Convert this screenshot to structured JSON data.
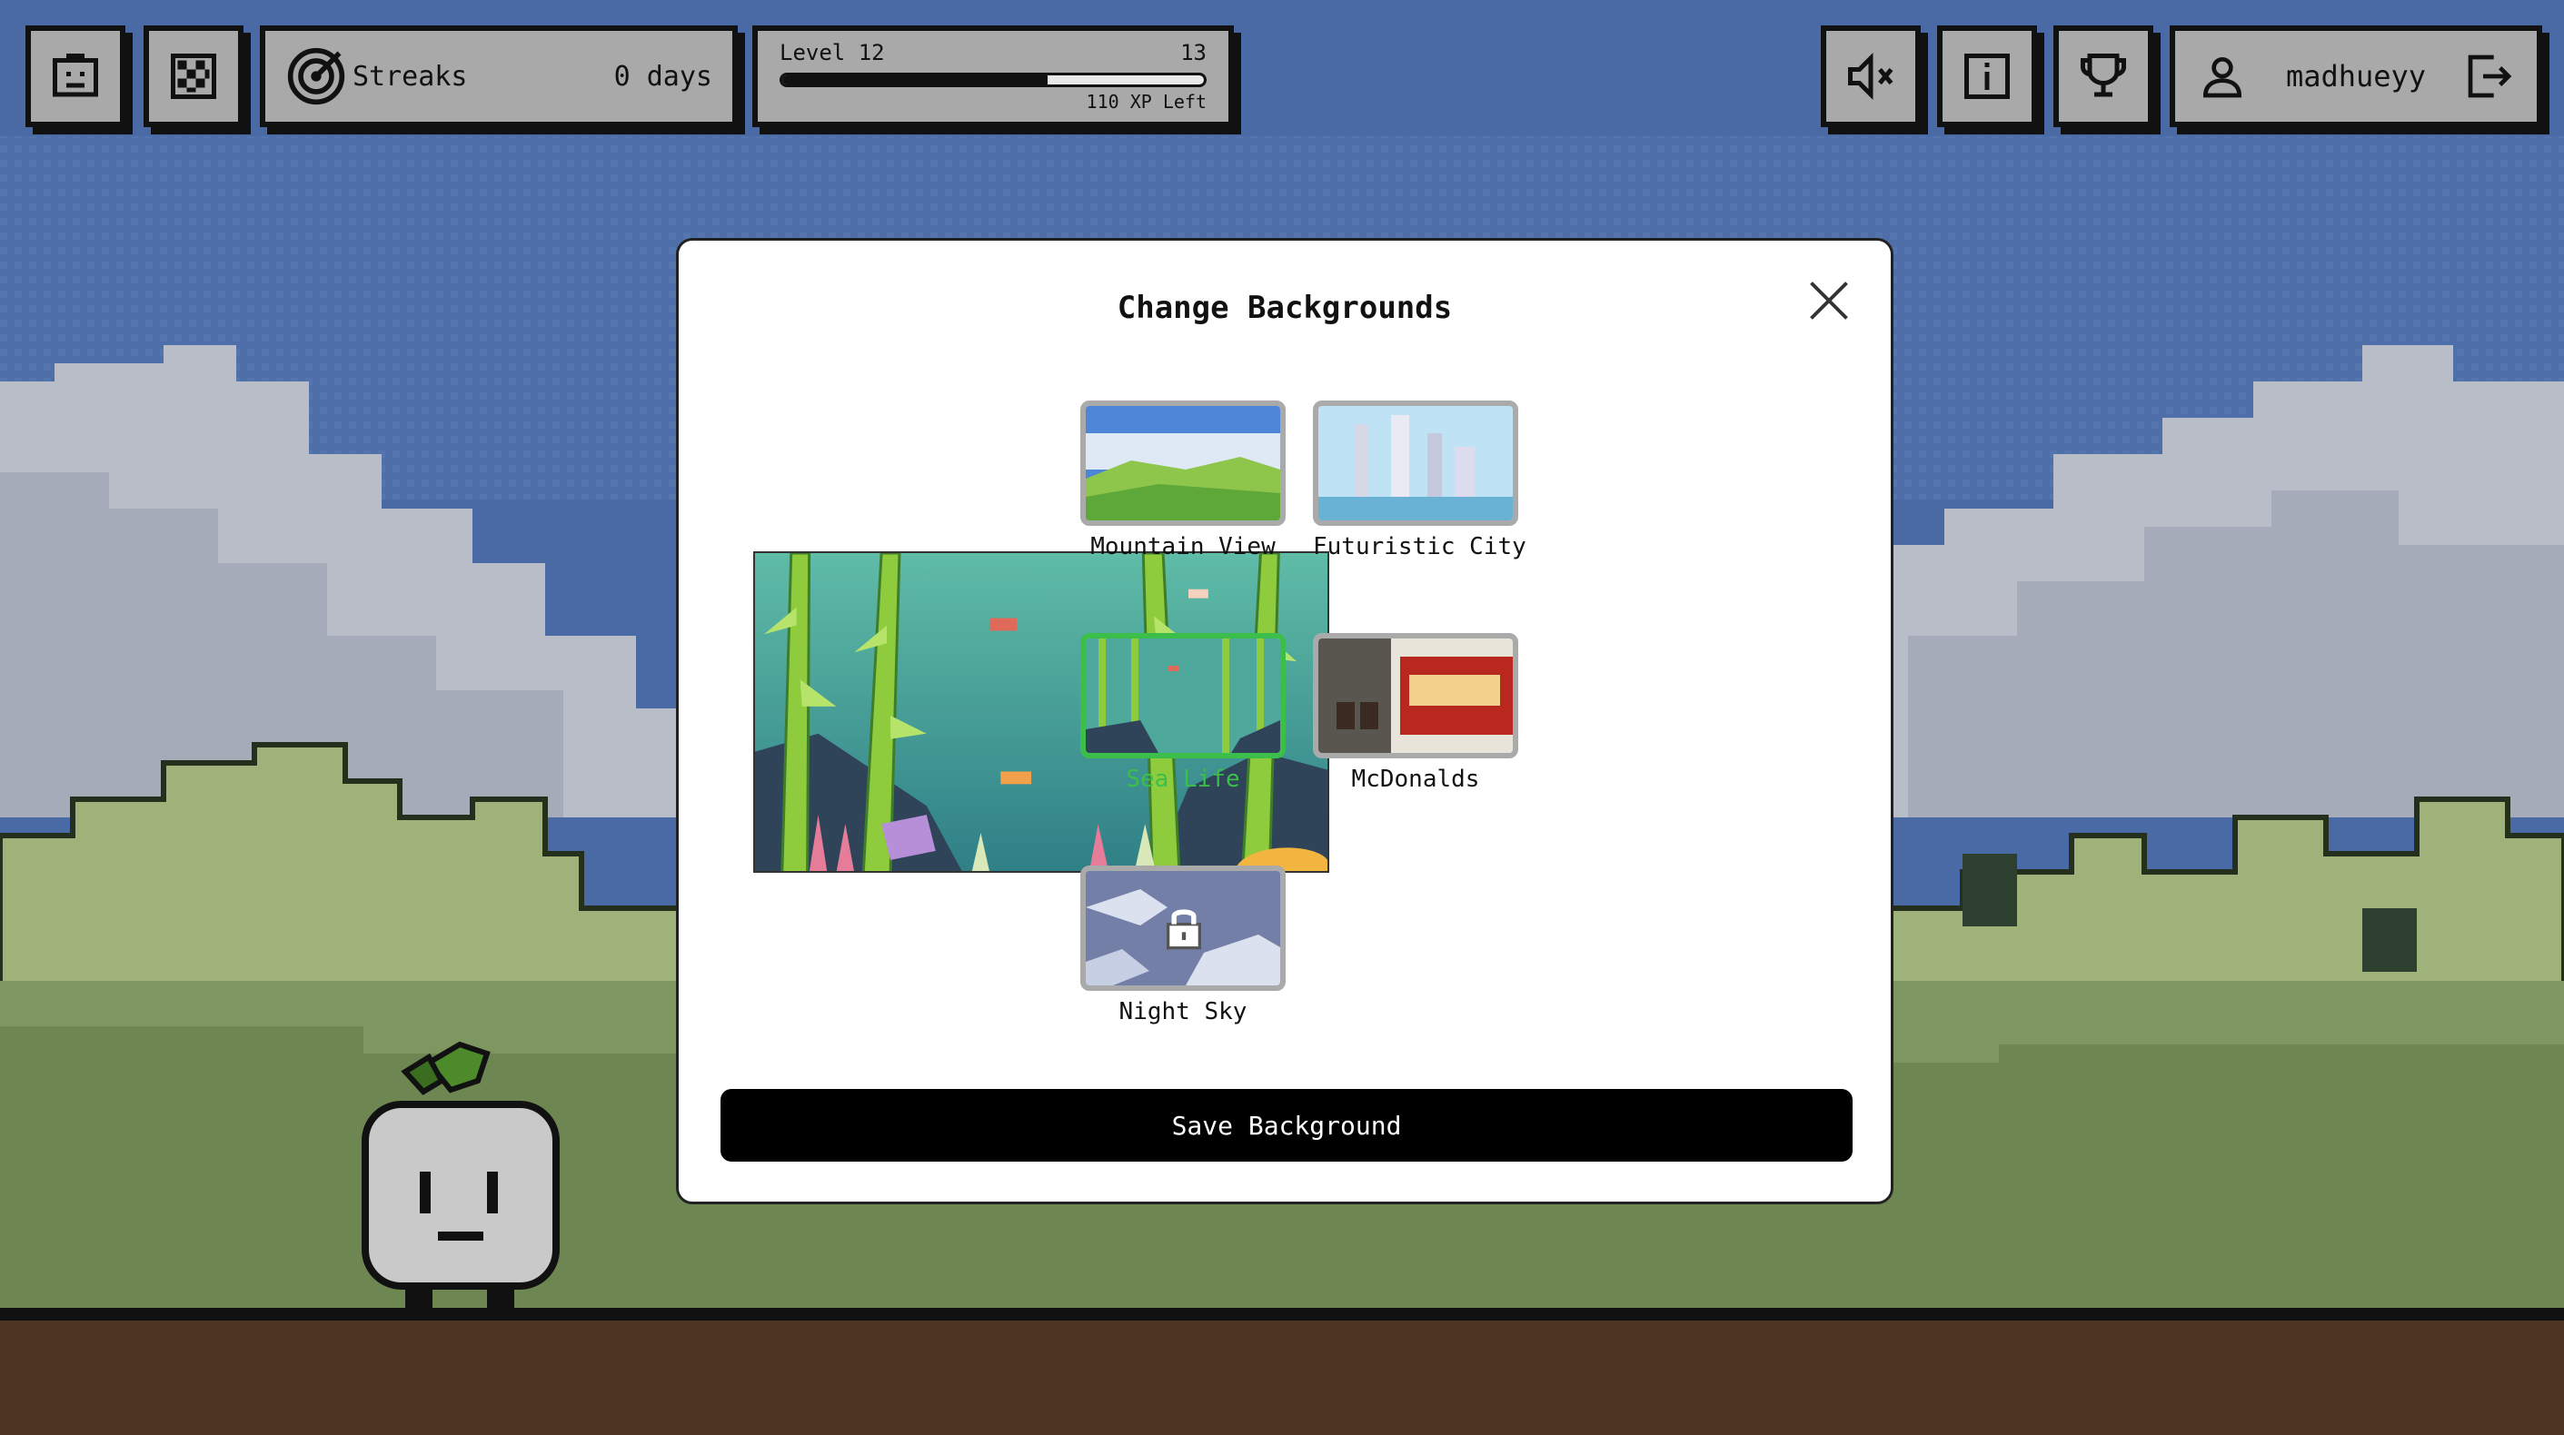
{
  "hud": {
    "streaks_label": "Streaks",
    "streaks_value": "0 days",
    "level_label": "Level 12",
    "next_level": "13",
    "xp_left": "110 XP Left",
    "level_progress": 0.63,
    "username": "madhueyy"
  },
  "modal": {
    "title": "Change Backgrounds",
    "save_label": "Save Background",
    "selected": "Sea Life",
    "backgrounds": [
      {
        "label": "Mountain View",
        "locked": false
      },
      {
        "label": "Futuristic City",
        "locked": false
      },
      {
        "label": "Sea Life",
        "locked": false
      },
      {
        "label": "McDonalds",
        "locked": false
      },
      {
        "label": "Night Sky",
        "locked": true
      }
    ]
  },
  "colors": {
    "selected_accent": "#3bbf4a",
    "sky": "#4c6ea8",
    "ground": "#4e3423",
    "hills": "#8fa86a"
  },
  "icons": [
    "smile-icon",
    "checker-icon",
    "target-icon",
    "mute-icon",
    "info-icon",
    "trophy-icon",
    "user-icon",
    "logout-icon",
    "close-icon",
    "lock-icon"
  ]
}
